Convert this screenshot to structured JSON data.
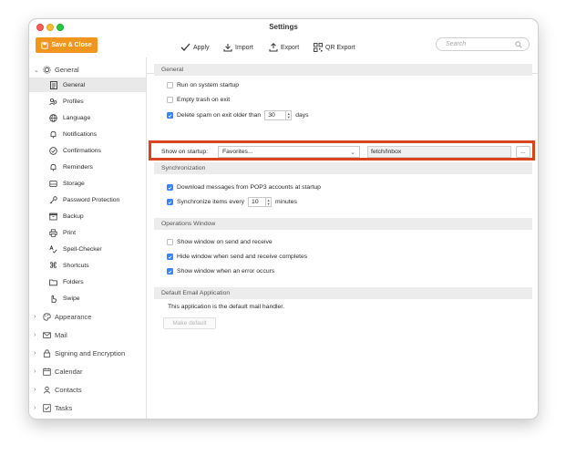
{
  "window": {
    "title": "Settings"
  },
  "toolbar": {
    "save_close": "Save & Close",
    "apply": "Apply",
    "import": "Import",
    "export": "Export",
    "qr_export": "QR Export",
    "search_placeholder": "Search"
  },
  "sidebar": {
    "top_group": "General",
    "items": [
      {
        "label": "General",
        "icon": "document-icon"
      },
      {
        "label": "Profiles",
        "icon": "people-icon"
      },
      {
        "label": "Language",
        "icon": "globe-icon"
      },
      {
        "label": "Notifications",
        "icon": "bell-icon"
      },
      {
        "label": "Confirmations",
        "icon": "check-circle-icon"
      },
      {
        "label": "Reminders",
        "icon": "bell-icon"
      },
      {
        "label": "Storage",
        "icon": "storage-icon"
      },
      {
        "label": "Password Protection",
        "icon": "key-icon"
      },
      {
        "label": "Backup",
        "icon": "box-icon"
      },
      {
        "label": "Print",
        "icon": "printer-icon"
      },
      {
        "label": "Spell-Checker",
        "icon": "spellcheck-icon"
      },
      {
        "label": "Shortcuts",
        "icon": "command-icon"
      },
      {
        "label": "Folders",
        "icon": "folder-icon"
      },
      {
        "label": "Swipe",
        "icon": "hand-icon"
      }
    ],
    "groups": [
      {
        "label": "Appearance",
        "icon": "palette-icon"
      },
      {
        "label": "Mail",
        "icon": "envelope-icon"
      },
      {
        "label": "Signing and Encryption",
        "icon": "lock-icon"
      },
      {
        "label": "Calendar",
        "icon": "calendar-icon"
      },
      {
        "label": "Contacts",
        "icon": "contacts-icon"
      },
      {
        "label": "Tasks",
        "icon": "tasks-icon"
      }
    ]
  },
  "general": {
    "heading": "General",
    "run_on_startup": {
      "label": "Run on system startup",
      "checked": false
    },
    "empty_trash": {
      "label": "Empty trash on exit",
      "checked": false
    },
    "delete_spam": {
      "label_before": "Delete spam on exit older than",
      "value": "30",
      "label_after": "days",
      "checked": true
    },
    "show_on_startup": {
      "label": "Show on startup:",
      "selected": "Favorites...",
      "path": "fetch/Inbox",
      "browse": "..."
    }
  },
  "synchronization": {
    "heading": "Synchronization",
    "download_pop3": {
      "label": "Download messages from POP3 accounts at startup",
      "checked": true
    },
    "sync_every": {
      "label_before": "Synchronize items every",
      "value": "10",
      "label_after": "minutes",
      "checked": true
    }
  },
  "operations": {
    "heading": "Operations Window",
    "items": [
      {
        "label": "Show window on send and receive",
        "checked": false
      },
      {
        "label": "Hide window when send and receive completes",
        "checked": true
      },
      {
        "label": "Show window when an error occurs",
        "checked": true
      }
    ]
  },
  "default_app": {
    "heading": "Default Email Application",
    "message": "This application is the default mail handler.",
    "button": "Make default"
  },
  "colors": {
    "accent": "#f0961e",
    "highlight": "#d8441c",
    "check": "#3a82f6"
  }
}
